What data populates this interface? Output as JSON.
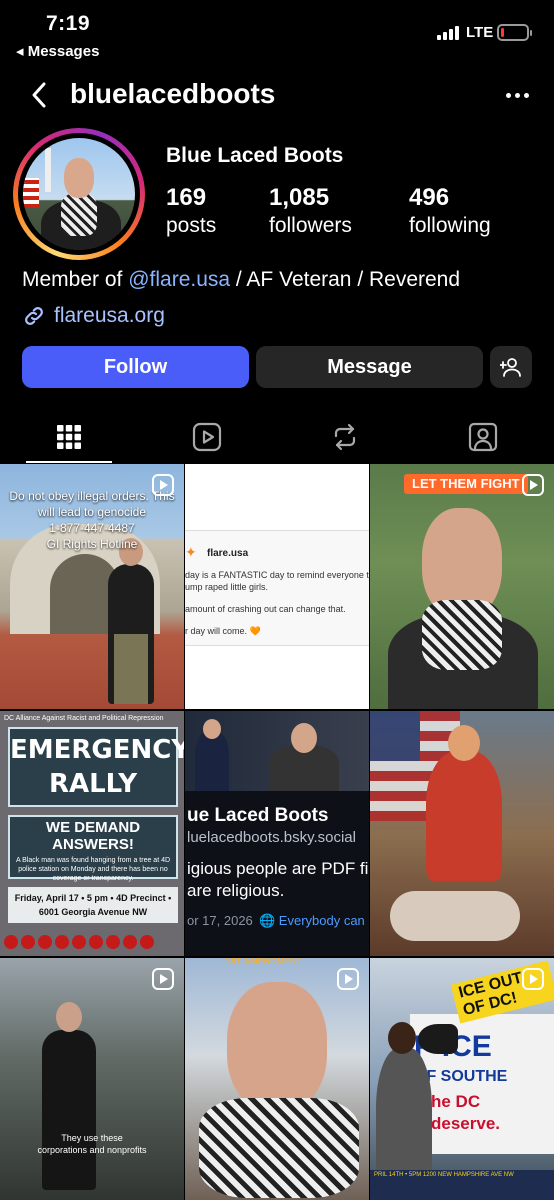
{
  "status_bar": {
    "time": "7:19",
    "back_app": "◂ Messages",
    "network": "LTE",
    "battery_level": 0.12,
    "battery_color": "#ff3b30"
  },
  "header": {
    "username": "bluelacedboots",
    "back_icon": "chevron-left-icon",
    "more_icon": "more-horizontal-icon"
  },
  "profile": {
    "display_name": "Blue Laced Boots",
    "stats": [
      {
        "value": "169",
        "label": "posts"
      },
      {
        "value": "1,085",
        "label": "followers"
      },
      {
        "value": "496",
        "label": "following"
      }
    ],
    "bio_prefix": "Member of ",
    "bio_mention": "@flare.usa",
    "bio_suffix": " / AF Veteran / Reverend",
    "link": "flareusa.org",
    "link_icon": "link-icon"
  },
  "actions": {
    "follow_label": "Follow",
    "message_label": "Message",
    "suggest_icon": "add-person-icon",
    "follow_color": "#4a5df9"
  },
  "tabs": [
    {
      "icon": "grid-icon",
      "active": true
    },
    {
      "icon": "reels-icon",
      "active": false
    },
    {
      "icon": "reposts-icon",
      "active": false
    },
    {
      "icon": "tagged-icon",
      "active": false
    }
  ],
  "posts": {
    "p1_overlay": [
      "Do not obey illegal orders. This",
      "will lead to genocide",
      "1-877-447-4487",
      "GI Rights Hotline"
    ],
    "p2_handle": "flare.usa",
    "p2_lines": [
      "day is a FANTASTIC day to remind everyone th",
      "ump raped little girls.",
      "amount of crashing out can change that.",
      "r day will come. 🧡"
    ],
    "p3_badge": "LET THEM FIGHT",
    "p4_top": "DC Alliance Against Racist and Political Repression",
    "p4_title": "EMERGENCY RALLY",
    "p4_demand": "WE DEMAND ANSWERS!",
    "p4_body": "A Black man was found hanging from a tree at 4D police station on Monday and there has been no coverage or transparency.",
    "p4_date1": "Friday, April 17 • 5 pm • 4D Precinct •",
    "p4_date2": "6001 Georgia Avenue NW",
    "p5_name": "ue Laced Boots",
    "p5_handle": "luelacedboots.bsky.social",
    "p5_line1": "igious people are PDF fi",
    "p5_line2": "are religious.",
    "p5_date": "or 17, 2026",
    "p5_reply": "🌐 Everybody can",
    "p7_caption": [
      "They use these",
      "corporations and nonprofits"
    ],
    "p8_top": "1ST AMENDMENT",
    "p9_ice": "ICE OUT OF DC!",
    "p9_banner1": "P ICE",
    "p9_banner2": "OF SOUTHE",
    "p9_banner3": "r the DC",
    "p9_banner4": "U deserve.",
    "p9_footer": "PRIL 14TH • 5PM  1200 NEW HAMPSHIRE AVE NW"
  }
}
